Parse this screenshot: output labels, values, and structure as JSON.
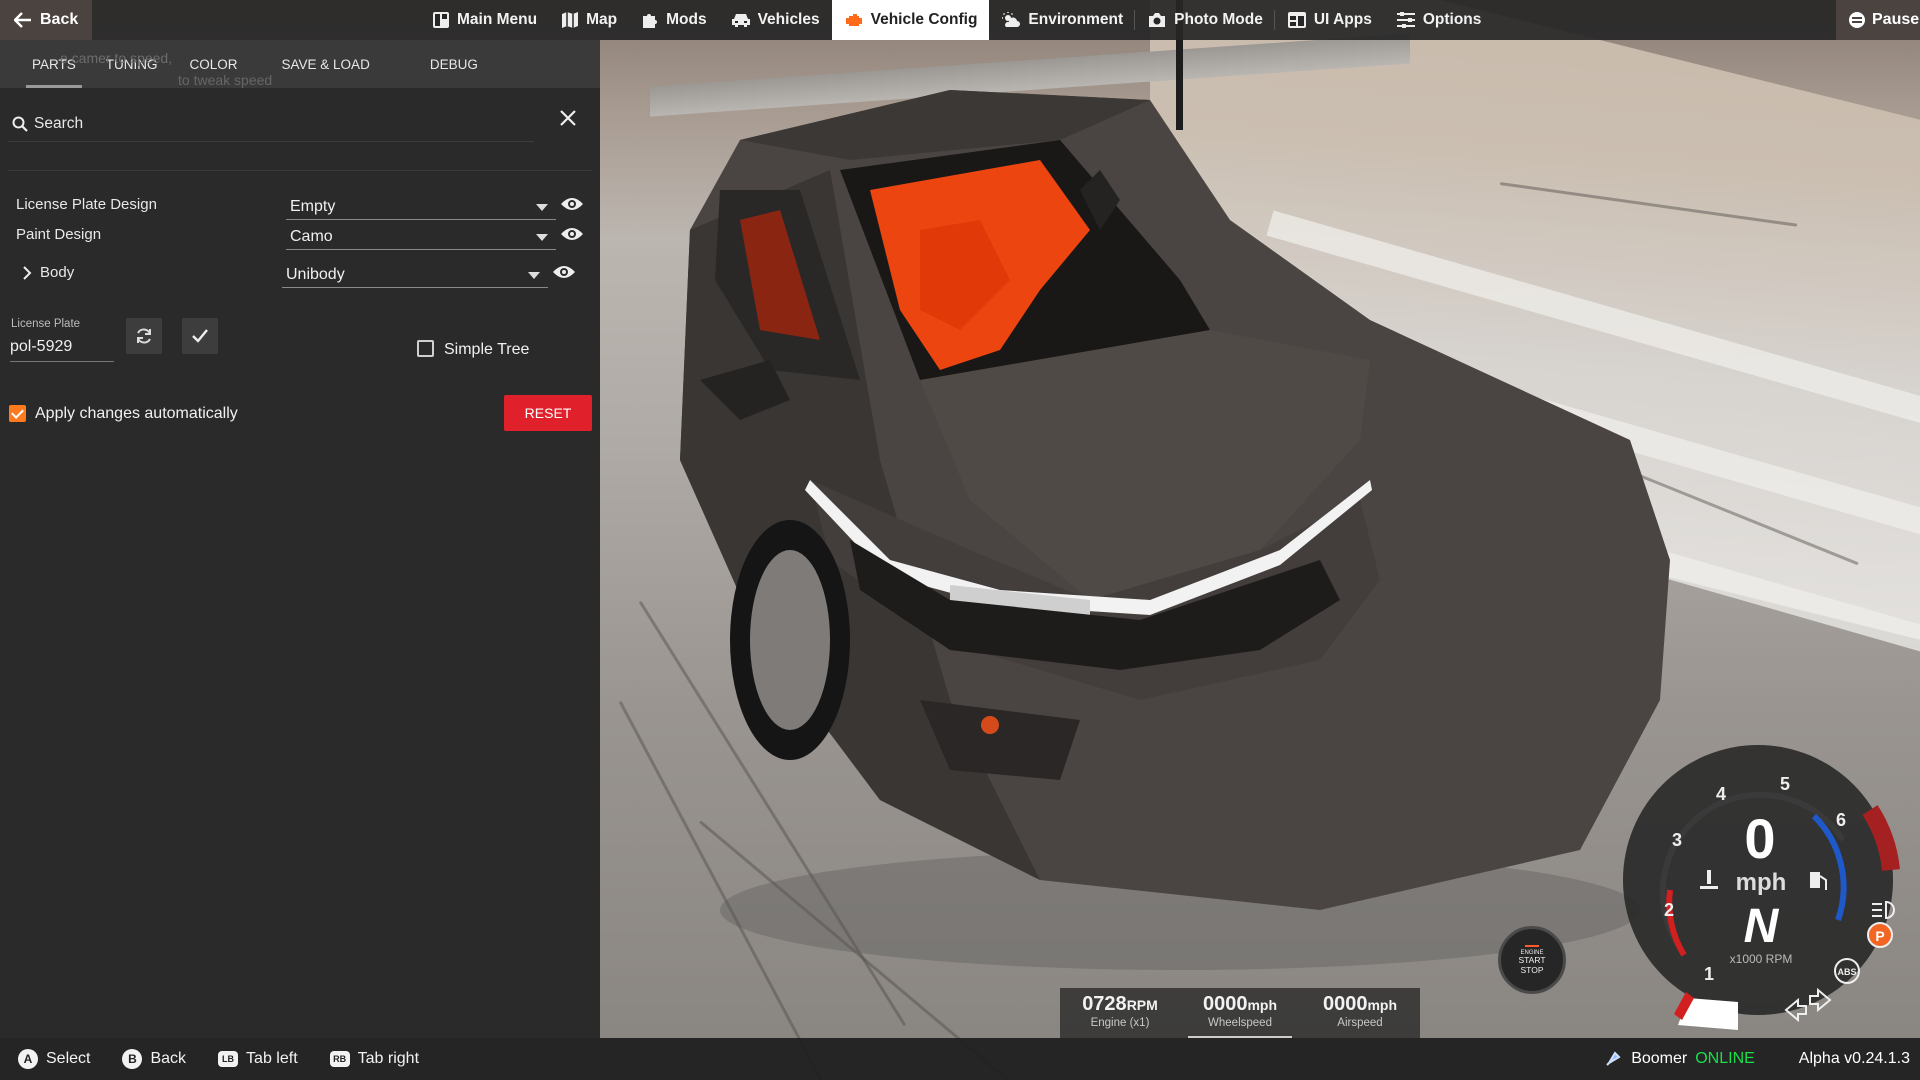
{
  "topbar": {
    "back_label": "Back",
    "menu": [
      {
        "label": "Main Menu",
        "icon": "main-menu-icon",
        "active": false
      },
      {
        "label": "Map",
        "icon": "map-icon",
        "active": false
      },
      {
        "label": "Mods",
        "icon": "puzzle-icon",
        "active": false
      },
      {
        "label": "Vehicles",
        "icon": "car-icon",
        "active": false
      },
      {
        "label": "Vehicle Config",
        "icon": "engine-icon",
        "active": true
      },
      {
        "label": "Environment",
        "icon": "weather-icon",
        "active": false
      },
      {
        "label": "Photo Mode",
        "icon": "camera-icon",
        "active": false
      },
      {
        "label": "UI Apps",
        "icon": "ui-apps-icon",
        "active": false
      },
      {
        "label": "Options",
        "icon": "sliders-icon",
        "active": false
      }
    ],
    "pause_label": "Pause",
    "accent_color": "#ff6a1a"
  },
  "panel": {
    "tabs": [
      {
        "label": "PARTS",
        "active": true
      },
      {
        "label": "TUNING",
        "active": false
      },
      {
        "label": "COLOR",
        "active": false
      },
      {
        "label": "SAVE & LOAD",
        "active": false
      },
      {
        "label": "DEBUG",
        "active": false
      }
    ],
    "ghost_hint_1": "e camer         to        speed,",
    "ghost_hint_2": "to tweak speed",
    "search_placeholder": "Search",
    "parts": [
      {
        "label": "License Plate Design",
        "value": "Empty",
        "expandable": false
      },
      {
        "label": "Paint Design",
        "value": "Camo",
        "expandable": false
      },
      {
        "label": "Body",
        "value": "Unibody",
        "expandable": true
      }
    ],
    "license_plate_label": "License Plate",
    "license_plate_value": "pol-5929",
    "simple_tree_label": "Simple Tree",
    "simple_tree_checked": false,
    "apply_auto_label": "Apply changes automatically",
    "apply_auto_checked": true,
    "reset_label": "RESET",
    "reset_color": "#e0202a"
  },
  "bottombar": {
    "hints": [
      {
        "button": "A",
        "label": "Select"
      },
      {
        "button": "B",
        "label": "Back"
      },
      {
        "button": "LB",
        "label": "Tab left"
      },
      {
        "button": "RB",
        "label": "Tab right"
      }
    ],
    "username": "Boomer",
    "status": "ONLINE",
    "status_color": "#19e04a",
    "version": "Alpha v0.24.1.3"
  },
  "readouts": [
    {
      "value": "0728",
      "unit": "RPM",
      "label": "Engine (x1)"
    },
    {
      "value": "0000",
      "unit": "mph",
      "label": "Wheelspeed"
    },
    {
      "value": "0000",
      "unit": "mph",
      "label": "Airspeed"
    }
  ],
  "engine_button": {
    "line1": "ENGINE",
    "line2": "START",
    "line3": "STOP"
  },
  "gauge": {
    "speed": "0",
    "speed_unit": "mph",
    "gear": "N",
    "rpm_label": "x1000 RPM",
    "rpm_ticks": [
      "1",
      "2",
      "3",
      "4",
      "5",
      "6"
    ],
    "parking_brake": "P",
    "abs_label": "ABS"
  }
}
